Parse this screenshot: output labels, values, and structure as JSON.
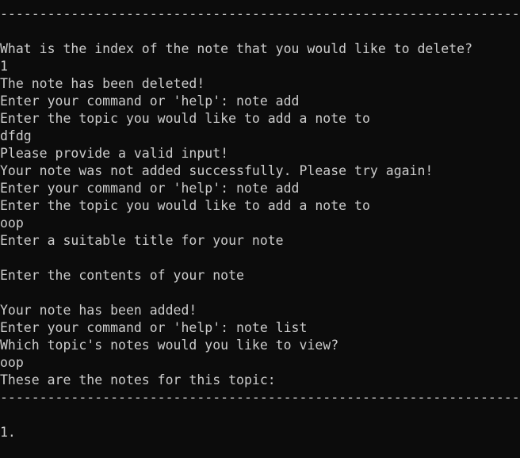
{
  "terminal": {
    "lines": [
      "",
      "What is the index of the note that you would like to delete?",
      "1",
      "The note has been deleted!",
      "Enter your command or 'help': note add",
      "Enter the topic you would like to add a note to",
      "dfdg",
      "Please provide a valid input!",
      "Your note was not added successfully. Please try again!",
      "Enter your command or 'help': note add",
      "Enter the topic you would like to add a note to",
      "oop",
      "Enter a suitable title for your note",
      "",
      "Enter the contents of your note",
      "",
      "Your note has been added!",
      "Enter your command or 'help': note list",
      "Which topic's notes would you like to view?",
      "oop",
      "These are the notes for this topic:",
      "",
      "",
      "1."
    ]
  }
}
